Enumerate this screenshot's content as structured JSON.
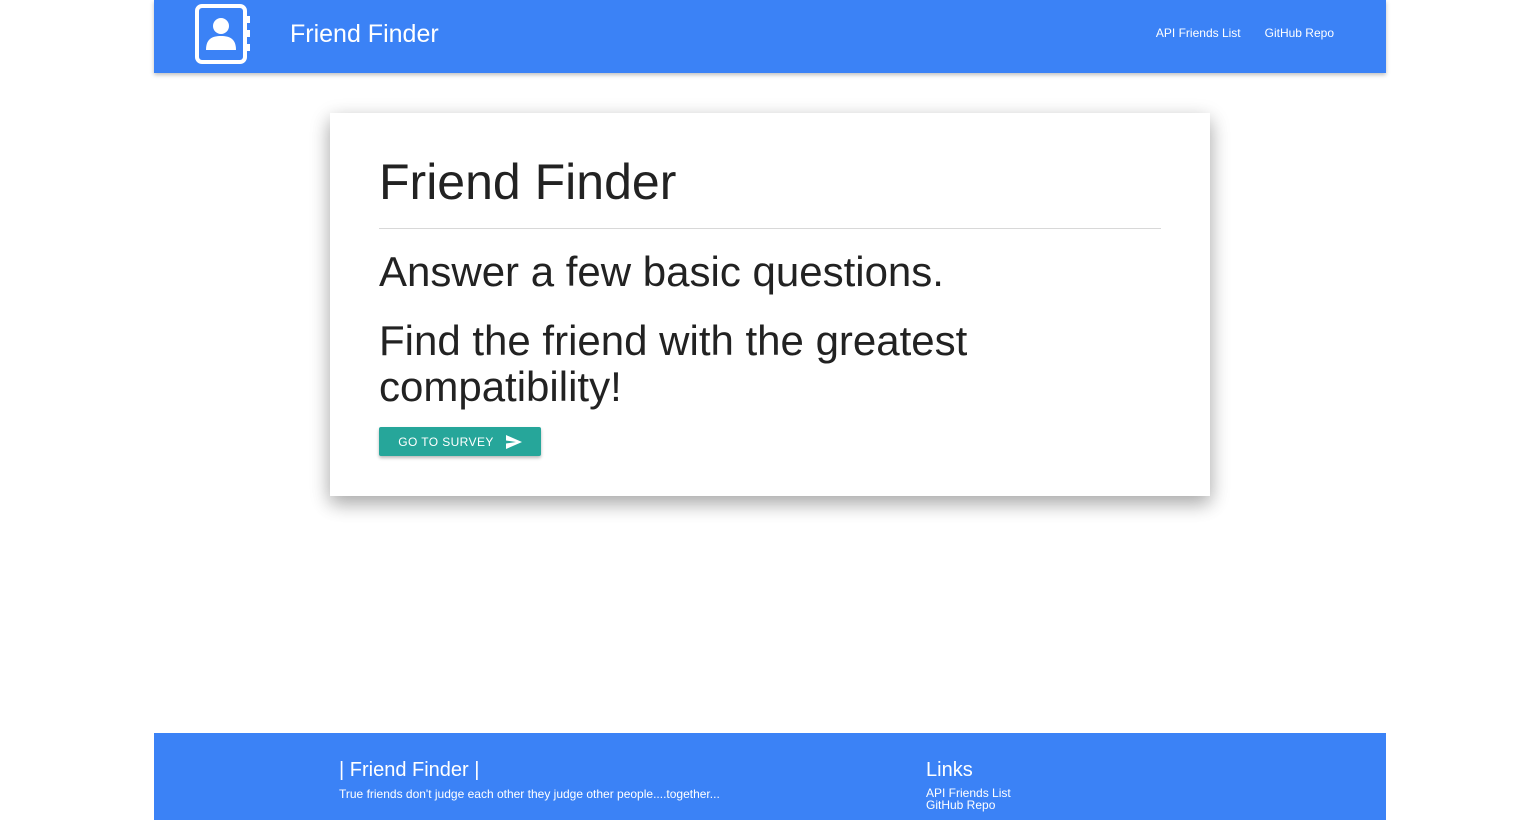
{
  "colors": {
    "brand": "#3b82f6",
    "accent": "#26a69a",
    "text": "#222222",
    "on_brand": "#ffffff"
  },
  "navbar": {
    "logo_icon": "address-book-icon",
    "title": "Friend Finder",
    "links": [
      {
        "label": "API Friends List"
      },
      {
        "label": "GitHub Repo"
      }
    ]
  },
  "hero": {
    "title": "Friend Finder",
    "line1": "Answer a few basic questions.",
    "line2": "Find the friend with the greatest compatibility!",
    "button": {
      "label": "GO TO SURVEY",
      "icon": "send-icon"
    }
  },
  "footer": {
    "title": "| Friend Finder |",
    "tagline": "True friends don't judge each other they judge other people....together...",
    "links_title": "Links",
    "links": [
      {
        "label": "API Friends List"
      },
      {
        "label": "GitHub Repo"
      }
    ]
  }
}
